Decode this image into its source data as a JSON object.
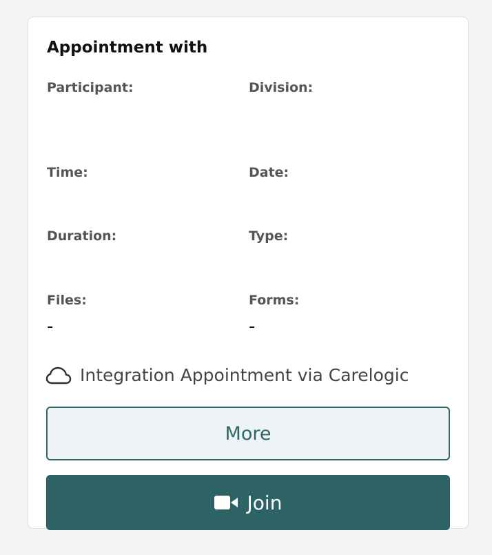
{
  "card": {
    "title": "Appointment with",
    "fields": {
      "participant_label": "Participant:",
      "division_label": "Division:",
      "time_label": "Time:",
      "date_label": "Date:",
      "duration_label": "Duration:",
      "type_label": "Type:",
      "files_label": "Files:",
      "files_value": "-",
      "forms_label": "Forms:",
      "forms_value": "-"
    },
    "integration": {
      "icon": "cloud-icon",
      "text": "Integration Appointment via Carelogic"
    },
    "buttons": {
      "more_label": "More",
      "join_label": "Join",
      "join_icon": "video-camera-icon"
    }
  },
  "colors": {
    "accent": "#2d6365",
    "more_background": "#eef4f5",
    "label_gray": "#555555"
  }
}
